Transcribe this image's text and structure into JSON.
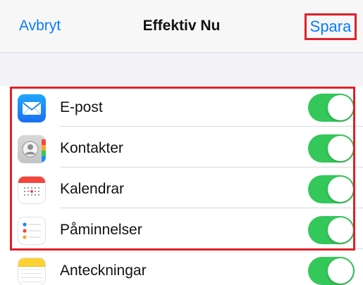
{
  "navbar": {
    "cancel_label": "Avbryt",
    "title": "Effektiv Nu",
    "save_label": "Spara"
  },
  "items": [
    {
      "label": "E-post",
      "icon": "mail-icon",
      "enabled": true
    },
    {
      "label": "Kontakter",
      "icon": "contacts-icon",
      "enabled": true
    },
    {
      "label": "Kalendrar",
      "icon": "calendar-icon",
      "enabled": true
    },
    {
      "label": "Påminnelser",
      "icon": "reminders-icon",
      "enabled": true
    },
    {
      "label": "Anteckningar",
      "icon": "notes-icon",
      "enabled": true
    }
  ],
  "colors": {
    "accent": "#0a7aff",
    "toggle_on": "#34c759",
    "highlight": "#e0202a"
  }
}
